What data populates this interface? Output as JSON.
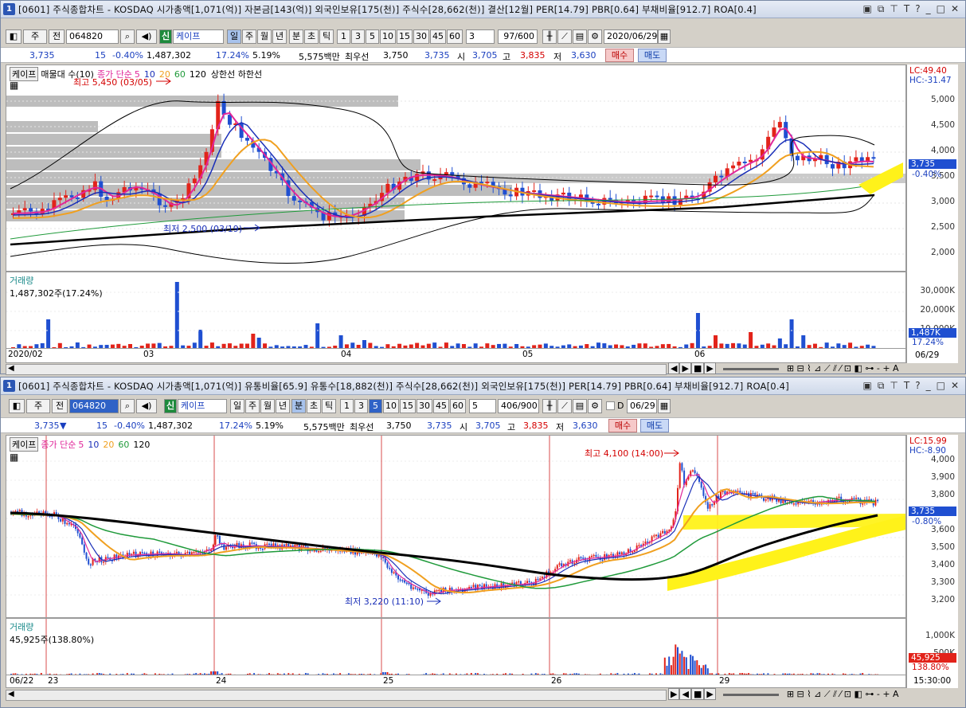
{
  "windows": [
    {
      "id": "daily",
      "number": "1",
      "title": "[0601] 주식종합차트 - KOSDAQ 시가총액[1,071(억)] 자본금[143(억)] 외국인보유[175(천)] 주식수[28,662(천)] 결산[12월] PER[14.79] PBR[0.64] 부채비율[912.7] ROA[0.4]",
      "toolbar": {
        "mode_main": "주",
        "mode_prev": "전",
        "code": "064820",
        "badge": "신",
        "name": "케이프",
        "periods": [
          "일",
          "주",
          "월",
          "년",
          "분",
          "초",
          "틱"
        ],
        "intervals": [
          "1",
          "3",
          "5",
          "10",
          "15",
          "30",
          "45",
          "60"
        ],
        "interval_value": "3",
        "count": "97/600",
        "date": "2020/06/29"
      },
      "quote": {
        "price": "3,735",
        "arrow": "▼",
        "change": "15",
        "change_pct": "-0.40%",
        "volume": "1,487,302",
        "turnover": "17.24%",
        "ratio": "5.19%",
        "amount": "5,575백만",
        "best_label": "최우선",
        "best_ask": "3,750",
        "best_bid": "3,735",
        "open_label": "시",
        "open": "3,705",
        "high_label": "고",
        "high": "3,835",
        "low_label": "저",
        "low": "3,630",
        "buy": "매수",
        "sell": "매도"
      },
      "price_legend": {
        "name": "케이프",
        "profile": "매물대 수(10)",
        "ma_label": "종가 단순",
        "mas": [
          "5",
          "10",
          "20",
          "60",
          "120"
        ],
        "bands": "상한선 하한선"
      },
      "price_annotations": {
        "high": "최고 5,450 (03/05)",
        "low": "최저 2,500 (03/19)"
      },
      "price_axis": {
        "labels": [
          "5,000",
          "4,500",
          "4,000",
          "3,500",
          "3,000",
          "2,500",
          "2,000"
        ],
        "top1": "LC:49.40",
        "top2": "HC:-31.47",
        "current": "3,735",
        "current_pct": "-0.40%"
      },
      "volume_legend": {
        "name": "거래량",
        "value": "1,487,302주(17.24%)"
      },
      "volume_axis": {
        "labels": [
          "30,000K",
          "20,000K",
          "10,000K"
        ],
        "current": "1,487K",
        "current_pct": "17.24%"
      },
      "dates": [
        "2020/02",
        "03",
        "04",
        "05",
        "06"
      ],
      "date_end": "06/29"
    },
    {
      "id": "minute",
      "number": "1",
      "title": "[0601] 주식종합차트 - KOSDAQ 시가총액[1,071(억)] 유통비율[65.9] 유통수[18,882(천)] 주식수[28,662(천)] 외국인보유[175(천)] PER[14.79] PBR[0.64] 부채비율[912.7] ROA[0.4]",
      "toolbar": {
        "mode_main": "주",
        "mode_prev": "전",
        "code": "064820",
        "badge": "신",
        "name": "케이프",
        "periods": [
          "일",
          "주",
          "월",
          "년",
          "분",
          "초",
          "틱"
        ],
        "intervals": [
          "1",
          "3",
          "5",
          "10",
          "15",
          "30",
          "45",
          "60"
        ],
        "interval_value": "5",
        "count": "406/900",
        "date_prefix": "D",
        "date": "06/29"
      },
      "quote": {
        "price": "3,735",
        "arrow": "▼",
        "change": "15",
        "change_pct": "-0.40%",
        "volume": "1,487,302",
        "turnover": "17.24%",
        "ratio": "5.19%",
        "amount": "5,575백만",
        "best_label": "최우선",
        "best_ask": "3,750",
        "best_bid": "3,735",
        "open_label": "시",
        "open": "3,705",
        "high_label": "고",
        "high": "3,835",
        "low_label": "저",
        "low": "3,630",
        "buy": "매수",
        "sell": "매도"
      },
      "price_legend": {
        "name": "케이프",
        "ma_label": "종가 단순",
        "mas": [
          "5",
          "10",
          "20",
          "60",
          "120"
        ]
      },
      "price_annotations": {
        "high": "최고 4,100 (14:00)",
        "low": "최저 3,220 (11:10)"
      },
      "price_axis": {
        "labels": [
          "4,000",
          "3,900",
          "3,800",
          "3,700",
          "3,600",
          "3,500",
          "3,400",
          "3,300",
          "3,200"
        ],
        "top1": "LC:15.99",
        "top2": "HC:-8.90",
        "current": "3,735",
        "current_pct": "-0.80%"
      },
      "volume_legend": {
        "name": "거래량",
        "value": "45,925주(138.80%)"
      },
      "volume_axis": {
        "labels": [
          "1,000K",
          "500K"
        ],
        "current": "45,925",
        "current_pct": "138.80%"
      },
      "dates": [
        "06/22",
        "23",
        "24",
        "25",
        "26",
        "29"
      ],
      "date_end": "15:30:00"
    }
  ],
  "colors": {
    "up": "#e2231a",
    "down": "#1f4fd1",
    "ma5": "#e0279a",
    "ma10": "#1a2fb8",
    "ma20": "#f0a020",
    "ma60": "#1f9a3a",
    "ma120": "#000000",
    "highlight": "#fff21a",
    "profile": "#bdbdbd"
  }
}
